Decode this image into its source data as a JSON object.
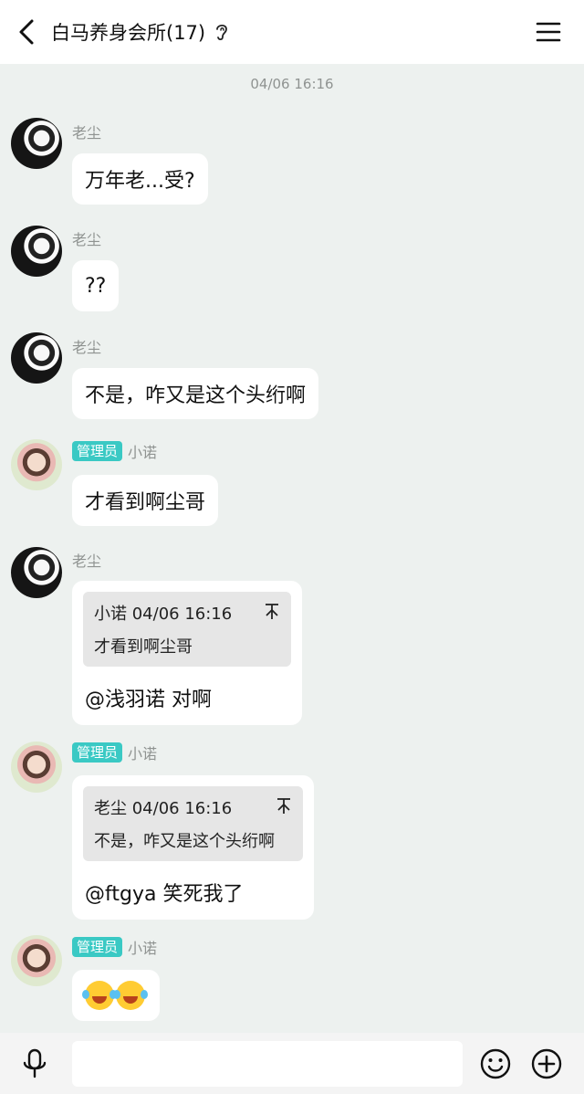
{
  "header": {
    "title": "白马养身会所(17)",
    "back_icon": "back-chevron-icon",
    "ear_icon": "ear-icon",
    "menu_icon": "menu-icon"
  },
  "timestamp": "04/06 16:16",
  "messages": [
    {
      "sender": "老尘",
      "text": "万年老...受?"
    },
    {
      "sender": "老尘",
      "text": "??"
    },
    {
      "sender": "老尘",
      "text": "不是，咋又是这个头绗啊"
    },
    {
      "badge": "管理员",
      "sender": "小诺",
      "text": "才看到啊尘哥"
    },
    {
      "sender": "老尘",
      "quote_head": "小诺 04/06 16:16",
      "quote_text": "才看到啊尘哥",
      "text": "@浅羽诺 对啊"
    },
    {
      "badge": "管理员",
      "sender": "小诺",
      "quote_head": "老尘 04/06 16:16",
      "quote_text": "不是，咋又是这个头绗啊",
      "text": "@ftgya 笑死我了"
    },
    {
      "badge": "管理员",
      "sender": "小诺",
      "emoji": "laughing-crying-emoji"
    }
  ],
  "bottom": {
    "input_placeholder": "",
    "mic_icon": "microphone-icon",
    "emoji_icon": "smile-icon",
    "plus_icon": "plus-icon"
  },
  "colors": {
    "background": "#edf1ef",
    "admin_badge": "#3ac9c4",
    "bubble": "#ffffff",
    "quote": "#e6e6e6"
  }
}
